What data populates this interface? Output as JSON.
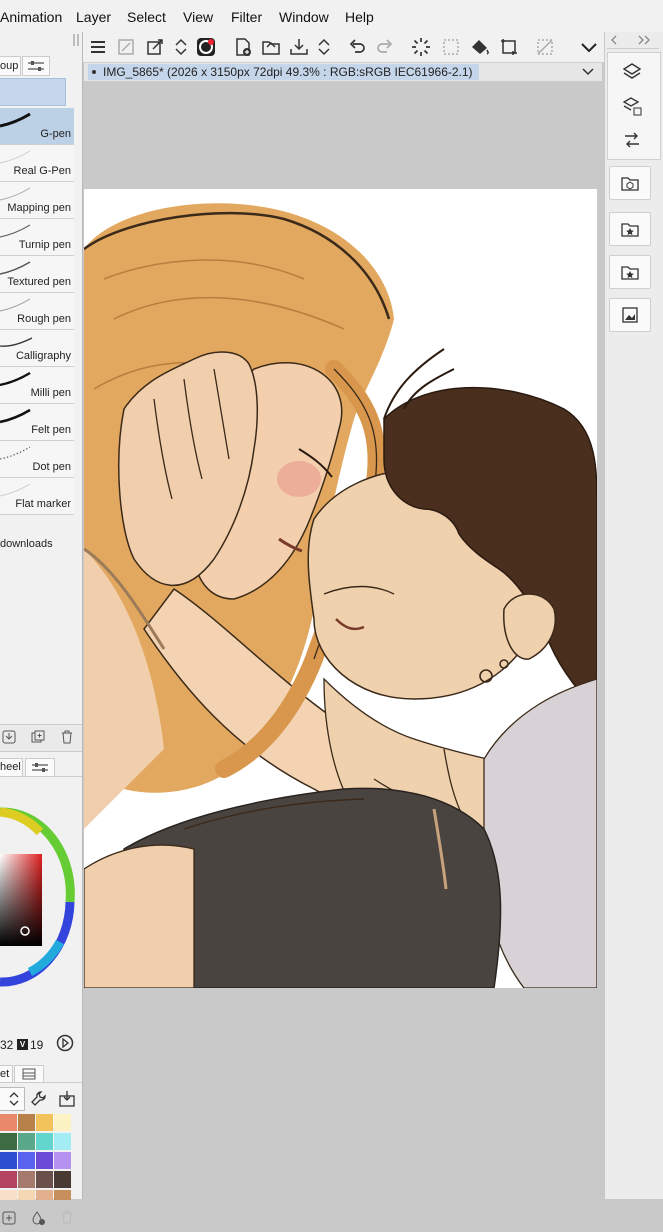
{
  "menu": [
    "Animation",
    "Layer",
    "Select",
    "View",
    "Filter",
    "Window",
    "Help"
  ],
  "left_panel": {
    "tab_label": "oup",
    "brushes": [
      {
        "label": "G-pen",
        "selected": true
      },
      {
        "label": "Real G-Pen",
        "selected": false
      },
      {
        "label": "Mapping pen",
        "selected": false
      },
      {
        "label": "Turnip pen",
        "selected": false
      },
      {
        "label": "Textured pen",
        "selected": false
      },
      {
        "label": "Rough pen",
        "selected": false
      },
      {
        "label": "Calligraphy",
        "selected": false
      },
      {
        "label": "Milli pen",
        "selected": false
      },
      {
        "label": "Felt pen",
        "selected": false
      },
      {
        "label": "Dot pen",
        "selected": false
      },
      {
        "label": "Flat marker",
        "selected": false
      }
    ],
    "downloads_label": "downloads",
    "color_tab_label": "heel",
    "color_values": {
      "s": "32",
      "v_label": "V",
      "v": "19"
    },
    "palette_tab_label": "et",
    "palette": [
      "#e9886a",
      "#b9814a",
      "#f2c35a",
      "#fcf3c4",
      "#3d6b44",
      "#5aa88a",
      "#62d6cc",
      "#a3ecf3",
      "#2c4ecf",
      "#5a63ef",
      "#6b4bd6",
      "#b791f2",
      "#b3435f",
      "#a57a6d",
      "#6b4f4a",
      "#4a3a34",
      "#f7dfc9",
      "#f6d7b4",
      "#e2b08d",
      "#c78f5c"
    ]
  },
  "document": {
    "title": "IMG_5865* (2026 x 3150px 72dpi 49.3% : RGB:sRGB IEC61966-2.1)"
  },
  "colors": {
    "accent": "#c6d6ea",
    "selected_brush": "#bcd0e6"
  }
}
